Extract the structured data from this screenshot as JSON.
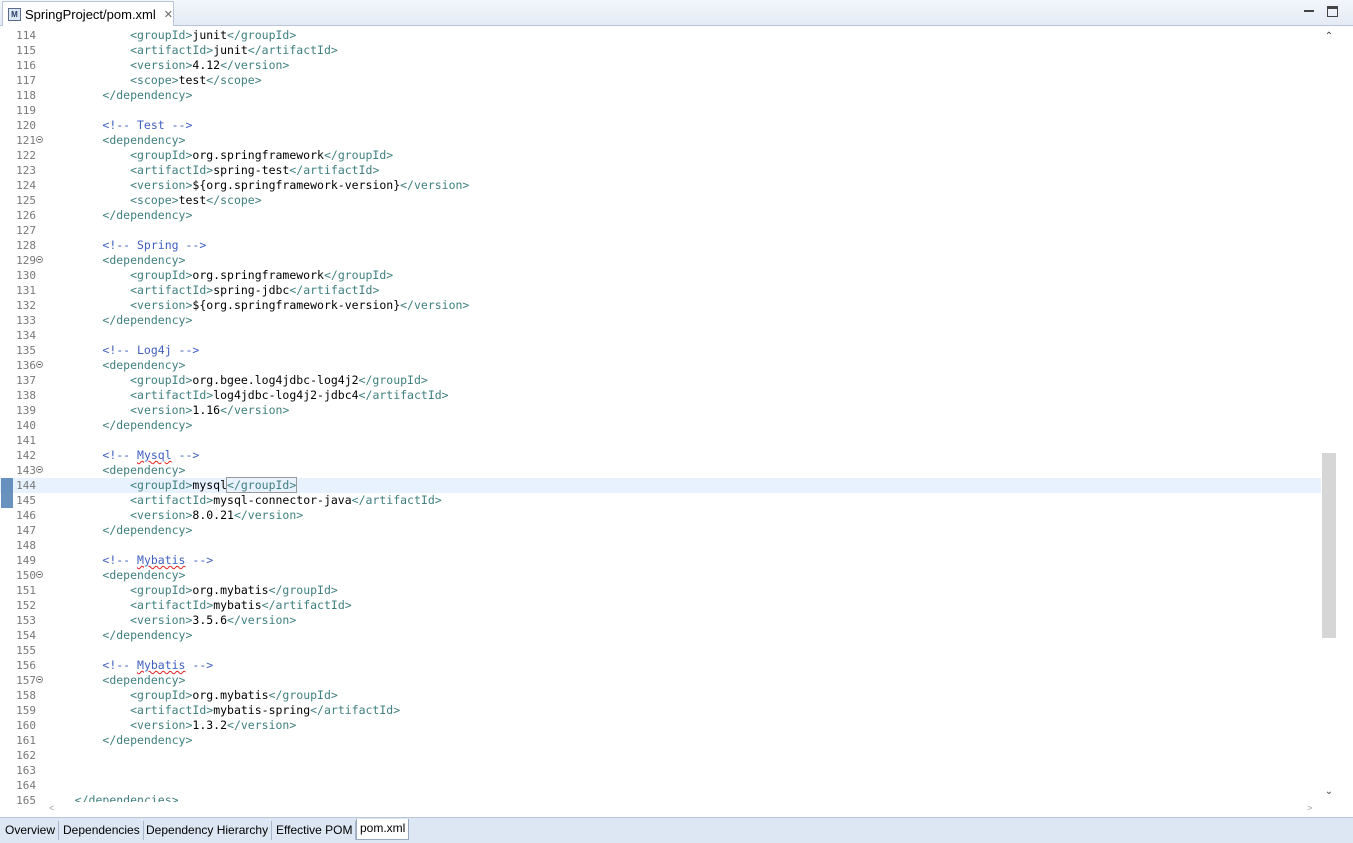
{
  "window": {
    "tab_title": "SpringProject/pom.xml",
    "tab_icon": "maven-pom-icon",
    "close_glyph": "✕",
    "scroll_up_glyph": "⌃",
    "scroll_down_glyph": "⌄",
    "scroll_left_glyph": "<",
    "scroll_right_glyph": ">"
  },
  "editor": {
    "current_line": 144,
    "lines": [
      {
        "n": "114"
      },
      {
        "n": "115"
      },
      {
        "n": "116"
      },
      {
        "n": "117"
      },
      {
        "n": "118"
      },
      {
        "n": "119"
      },
      {
        "n": "120"
      },
      {
        "n": "121"
      },
      {
        "n": "122"
      },
      {
        "n": "123"
      },
      {
        "n": "124"
      },
      {
        "n": "125"
      },
      {
        "n": "126"
      },
      {
        "n": "127"
      },
      {
        "n": "128"
      },
      {
        "n": "129"
      },
      {
        "n": "130"
      },
      {
        "n": "131"
      },
      {
        "n": "132"
      },
      {
        "n": "133"
      },
      {
        "n": "134"
      },
      {
        "n": "135"
      },
      {
        "n": "136"
      },
      {
        "n": "137"
      },
      {
        "n": "138"
      },
      {
        "n": "139"
      },
      {
        "n": "140"
      },
      {
        "n": "141"
      },
      {
        "n": "142"
      },
      {
        "n": "143"
      },
      {
        "n": "144"
      },
      {
        "n": "145"
      },
      {
        "n": "146"
      },
      {
        "n": "147"
      },
      {
        "n": "148"
      },
      {
        "n": "149"
      },
      {
        "n": "150"
      },
      {
        "n": "151"
      },
      {
        "n": "152"
      },
      {
        "n": "153"
      },
      {
        "n": "154"
      },
      {
        "n": "155"
      },
      {
        "n": "156"
      },
      {
        "n": "157"
      },
      {
        "n": "158"
      },
      {
        "n": "159"
      },
      {
        "n": "160"
      },
      {
        "n": "161"
      },
      {
        "n": "162"
      },
      {
        "n": "163"
      },
      {
        "n": "164"
      },
      {
        "n": "165"
      }
    ],
    "values": {
      "junit": "junit",
      "v412": "4.12",
      "test": "test",
      "c_test": "<!-- Test -->",
      "springfw": "org.springframework",
      "spring_test": "spring-test",
      "spring_version": "${org.springframework-version}",
      "c_spring": "<!-- Spring -->",
      "spring_jdbc": "spring-jdbc",
      "c_log4j": "<!-- Log4j -->",
      "bgee": "org.bgee.log4jdbc-log4j2",
      "log4j_art": "log4jdbc-log4j2-jdbc4",
      "v116": "1.16",
      "c_mysql_open": "<!-- ",
      "mysql_word": "Mysql",
      "c_close": " -->",
      "mysql": "mysql",
      "mysql_conn": "mysql-connector-java",
      "v8021": "8.0.21",
      "mybatis_word": "Mybatis",
      "org_mybatis": "org.mybatis",
      "mybatis": "mybatis",
      "v356": "3.5.6",
      "mybatis_spring": "mybatis-spring",
      "v132": "1.3.2"
    },
    "tags": {
      "groupId_o": "<groupId>",
      "groupId_c": "</groupId>",
      "artifactId_o": "<artifactId>",
      "artifactId_c": "</artifactId>",
      "version_o": "<version>",
      "version_c": "</version>",
      "scope_o": "<scope>",
      "scope_c": "</scope>",
      "dep_o": "<dependency>",
      "dep_c": "</dependency>",
      "deps_c": "</dependencies>"
    }
  },
  "page_tabs": [
    "Overview",
    "Dependencies",
    "Dependency Hierarchy",
    "Effective POM",
    "pom.xml"
  ],
  "active_page_tab": "pom.xml",
  "colors": {
    "tag": "#3f7f7f",
    "comment": "#3f5fbf",
    "current_line_bg": "#e8f2fe",
    "tab_bar": "#dde7f3"
  }
}
